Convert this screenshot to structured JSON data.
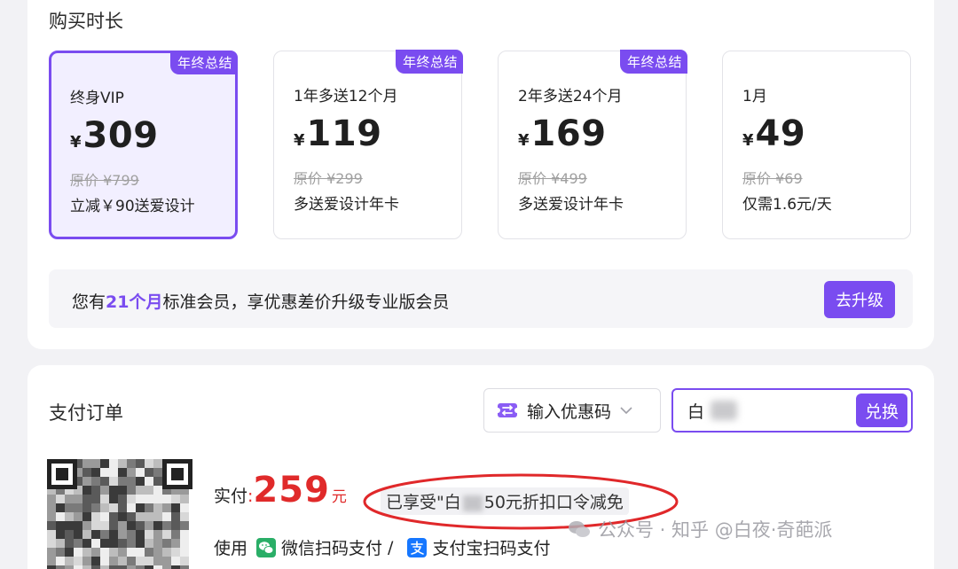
{
  "duration": {
    "title": "购买时长",
    "plans": [
      {
        "badge": "年终总结",
        "name": "终身VIP",
        "currency": "¥",
        "price": "309",
        "original": "原价 ¥799",
        "perk": "立减￥90送爱设计",
        "selected": true
      },
      {
        "badge": "年终总结",
        "name": "1年多送12个月",
        "currency": "¥",
        "price": "119",
        "original": "原价 ¥299",
        "perk": "多送爱设计年卡",
        "selected": false
      },
      {
        "badge": "年终总结",
        "name": "2年多送24个月",
        "currency": "¥",
        "price": "169",
        "original": "原价 ¥499",
        "perk": "多送爱设计年卡",
        "selected": false
      },
      {
        "badge": "",
        "name": "1月",
        "currency": "¥",
        "price": "49",
        "original": "原价 ¥69",
        "perk": "仅需1.6元/天",
        "selected": false
      }
    ],
    "upgrade": {
      "prefix": "您有",
      "months": "21个月",
      "suffix": "标准会员，享优惠差价升级专业版会员",
      "button": "去升级"
    }
  },
  "order": {
    "title": "支付订单",
    "coupon_select_label": "输入优惠码",
    "coupon_input_value": "白",
    "redeem_button": "兑换",
    "pay_label": "实付",
    "pay_colon": ":",
    "pay_amount": "259",
    "pay_unit": "元",
    "discount_prefix": "已享受\"白",
    "discount_suffix": "50元折扣口令减免",
    "method_prefix": "使用",
    "wechat_label": "微信扫码支付",
    "method_sep": "/",
    "alipay_label": "支付宝扫码支付"
  },
  "watermark": "公众号 · 知乎 @白夜·奇葩派",
  "colors": {
    "accent": "#7a4cf0",
    "price_red": "#e02a2a",
    "annotation_red": "#e0282a",
    "wechat_green": "#2aae67",
    "alipay_blue": "#1677ff"
  }
}
